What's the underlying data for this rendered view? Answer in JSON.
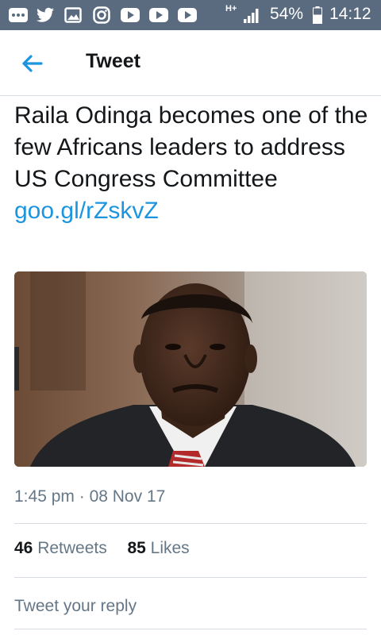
{
  "status_bar": {
    "icons": [
      "more-icon",
      "twitter-icon",
      "gallery-icon",
      "instagram-icon",
      "youtube-icon",
      "youtube-icon",
      "youtube-icon"
    ],
    "network": "H+",
    "battery": "54%",
    "time": "14:12"
  },
  "header": {
    "title": "Tweet"
  },
  "tweet": {
    "text": "Raila Odinga becomes one of the few Africans leaders to address US Congress Committee",
    "link": "goo.gl/rZskvZ",
    "time": "1:45 pm",
    "separator": "·",
    "date": "08 Nov 17",
    "retweets_count": "46",
    "retweets_label": "Retweets",
    "likes_count": "85",
    "likes_label": "Likes"
  },
  "reply": {
    "placeholder": "Tweet your reply"
  },
  "colors": {
    "status_bar": "#5a6b7f",
    "accent": "#1b95e0",
    "secondary_text": "#657786"
  }
}
